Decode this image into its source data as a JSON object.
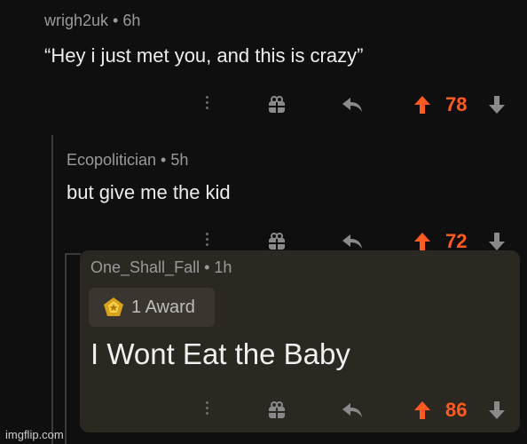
{
  "comments": [
    {
      "username": "wrigh2uk • 6h",
      "body": "“Hey i just met you, and this is crazy”",
      "score": "78"
    },
    {
      "username": "Ecopolitician • 5h",
      "body": "but give me the kid",
      "score": "72"
    },
    {
      "username": "One_Shall_Fall • 1h",
      "award": "1 Award",
      "body": "I Wont Eat the Baby",
      "score": "86"
    }
  ],
  "colors": {
    "background": "#0f0f0f",
    "upvote_accent": "#ff5a1f",
    "highlight_card": "#2b2822"
  },
  "icons": [
    "more-icon",
    "gift-icon",
    "reply-icon",
    "upvote-icon",
    "downvote-icon",
    "award-icon"
  ],
  "watermark": "imgflip.com"
}
